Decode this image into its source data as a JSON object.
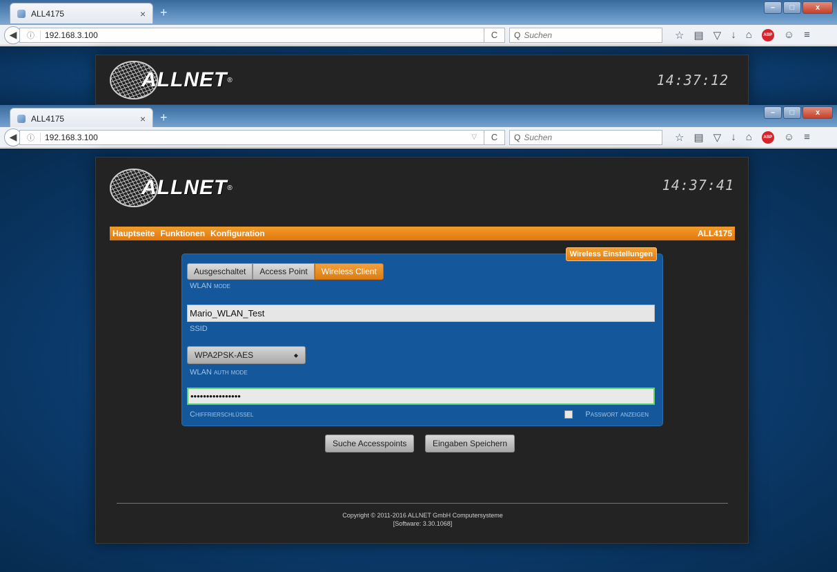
{
  "back_window": {
    "tab_title": "ALL4175",
    "tab_close": "×",
    "new_tab": "+",
    "url": "192.168.3.100",
    "search_placeholder": "Suchen",
    "clock": "14:37:12",
    "brand": "ALLNET",
    "reg_mark": "®"
  },
  "front_window": {
    "tab_title": "ALL4175",
    "tab_close": "×",
    "new_tab": "+",
    "url": "192.168.3.100",
    "search_placeholder": "Suchen",
    "clock": "14:37:41",
    "brand": "ALLNET",
    "reg_mark": "®"
  },
  "toolbar": {
    "info_icon": "ⓘ",
    "reload_icon": "C",
    "search_icon": "Q",
    "abp_label": "ABP"
  },
  "menu": {
    "items": [
      "Hauptseite",
      "Funktionen",
      "Konfiguration"
    ],
    "device": "ALL4175"
  },
  "wireless": {
    "box_title": "Wireless Einstellungen",
    "modes": [
      "Ausgeschaltet",
      "Access Point",
      "Wireless Client"
    ],
    "active_mode": "Wireless Client",
    "mode_label": "WLAN mode",
    "ssid_value": "Mario_WLAN_Test",
    "ssid_label": "SSID",
    "auth_value": "WPA2PSK-AES",
    "auth_label": "WLAN auth mode",
    "key_value": "••••••••••••••••",
    "key_label": "Chiffrierschlüssel",
    "show_password_label": "Passwort anzeigen",
    "show_password_checked": false
  },
  "buttons": {
    "search_ap": "Suche Accesspoints",
    "save": "Eingaben Speichern"
  },
  "footer": {
    "copyright": "Copyright © 2011-2016 ALLNET GmbH Computersysteme",
    "software": "[Software: 3.30.1068]"
  }
}
